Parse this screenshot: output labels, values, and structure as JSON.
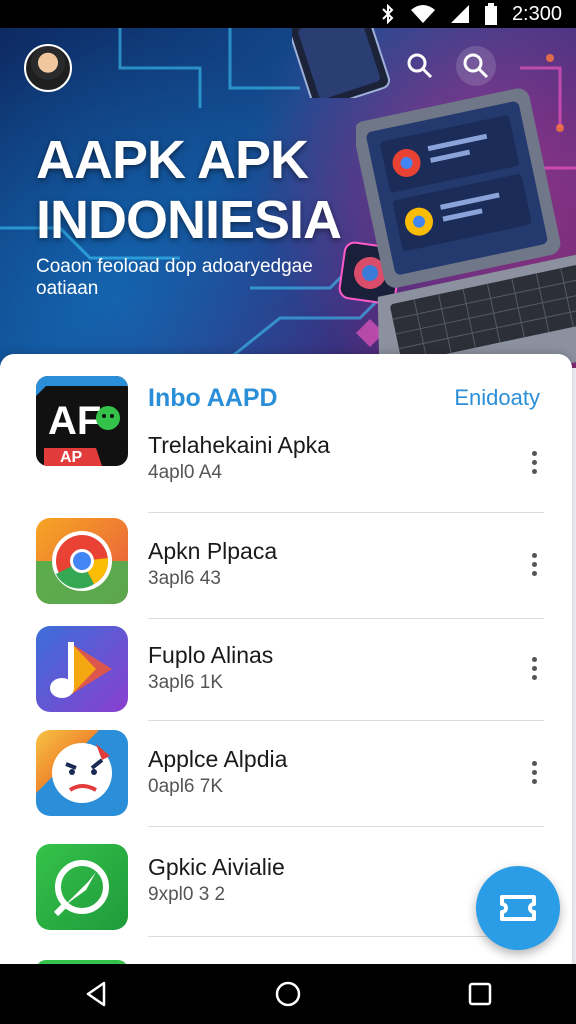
{
  "status_bar": {
    "time": "2:300",
    "icons": [
      "bluetooth-icon",
      "wifi-icon",
      "signal-icon",
      "battery-icon"
    ]
  },
  "hero": {
    "title": "AAPK APK INDONIESIA",
    "subtitle": "Coaon feoload dop adoaryedgae oatiaan",
    "icons": [
      "avatar",
      "search-icon",
      "search-icon"
    ]
  },
  "section": {
    "title": "Inbo AAPD",
    "link": "Enidoaty"
  },
  "apps": [
    {
      "name": "Trelahekaini Apka",
      "meta": "4apl0 A4",
      "icon": "af-app-icon"
    },
    {
      "name": "Apkn Plpaca",
      "meta": "3apl6 43",
      "icon": "chrome-icon"
    },
    {
      "name": "Fuplo Alinas",
      "meta": "3apl6 1K",
      "icon": "play-icon"
    },
    {
      "name": "Applce Alpdia",
      "meta": "0apl6 7K",
      "icon": "face-app-icon"
    },
    {
      "name": "Gpkic Aivialie",
      "meta": "9xpl0 3 2",
      "icon": "compass-app-icon"
    }
  ],
  "fab": {
    "icon": "ticket-icon"
  },
  "nav": {
    "icons": [
      "back-icon",
      "home-icon",
      "recents-icon"
    ]
  },
  "colors": {
    "accent": "#2a8fd8",
    "fab": "#2b9de6",
    "hero_start": "#0d2a63",
    "hero_end": "#7a2a6e"
  }
}
